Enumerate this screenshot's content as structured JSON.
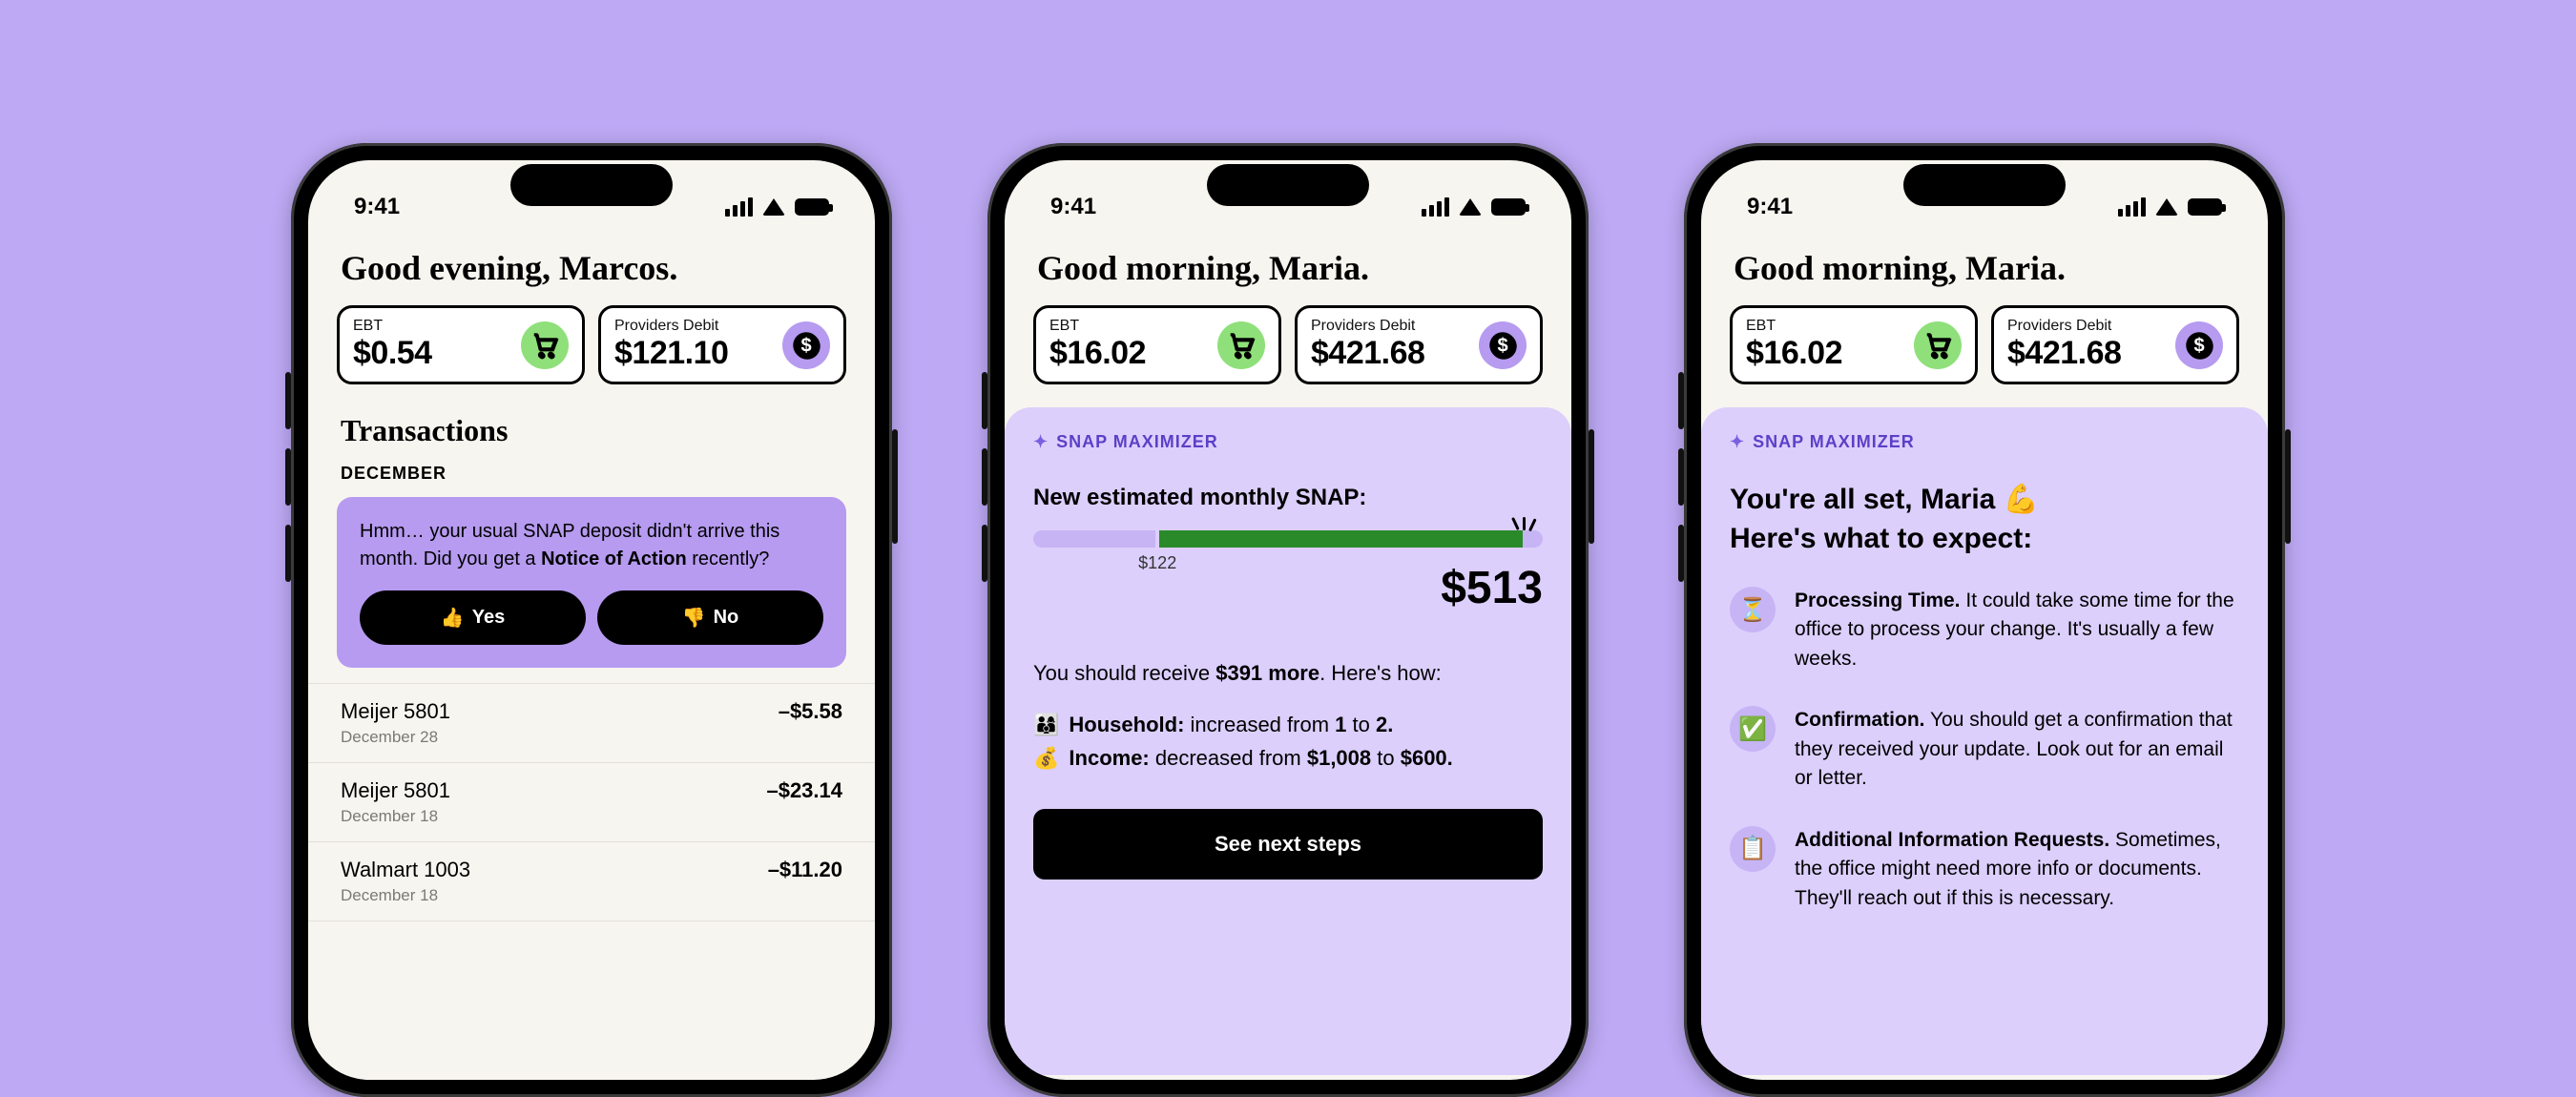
{
  "status_time": "9:41",
  "phone1": {
    "greeting": "Good evening, Marcos.",
    "ebt_label": "EBT",
    "ebt_amount": "$0.54",
    "debit_label": "Providers Debit",
    "debit_amount": "$121.10",
    "transactions_title": "Transactions",
    "month": "DECEMBER",
    "alert_text_pre": "Hmm… your usual SNAP deposit didn't arrive this month. Did you get a ",
    "alert_text_bold": "Notice of Action",
    "alert_text_post": " recently?",
    "yes_label": "Yes",
    "no_label": "No",
    "transactions": [
      {
        "merchant": "Meijer 5801",
        "date": "December 28",
        "amount": "–$5.58"
      },
      {
        "merchant": "Meijer 5801",
        "date": "December 18",
        "amount": "–$23.14"
      },
      {
        "merchant": "Walmart 1003",
        "date": "December 18",
        "amount": "–$11.20"
      }
    ]
  },
  "phone2": {
    "greeting": "Good morning, Maria.",
    "ebt_label": "EBT",
    "ebt_amount": "$16.02",
    "debit_label": "Providers Debit",
    "debit_amount": "$421.68",
    "snap_header": "SNAP MAXIMIZER",
    "estimate_title": "New estimated monthly SNAP:",
    "old_amount_label": "$122",
    "new_amount": "$513",
    "bar_old_pct": 24,
    "bar_new_pct": 96,
    "increase_pre": "You should receive ",
    "increase_bold": "$391 more",
    "increase_post": ". Here's how:",
    "household_label": "Household:",
    "household_change_pre": " increased from ",
    "household_from": "1",
    "household_mid": " to ",
    "household_to": "2.",
    "income_label": "Income:",
    "income_change_pre": " decreased from ",
    "income_from": "$1,008",
    "income_mid": " to ",
    "income_to": "$600.",
    "cta_label": "See next steps"
  },
  "phone3": {
    "greeting": "Good morning, Maria.",
    "ebt_label": "EBT",
    "ebt_amount": "$16.02",
    "debit_label": "Providers Debit",
    "debit_amount": "$421.68",
    "snap_header": "SNAP MAXIMIZER",
    "allset_line1": "You're all set, Maria 💪",
    "allset_line2": "Here's what to expect:",
    "items": [
      {
        "icon": "⏳",
        "title": "Processing Time.",
        "body": " It could take some time for the office to process your change. It's usually a few weeks."
      },
      {
        "icon": "✅",
        "title": "Confirmation.",
        "body": " You should get a confirmation that they received your update. Look out for an email or letter."
      },
      {
        "icon": "📋",
        "title": "Additional Information Requests.",
        "body": " Sometimes, the office might need more info or documents. They'll reach out if this is necessary."
      }
    ]
  }
}
